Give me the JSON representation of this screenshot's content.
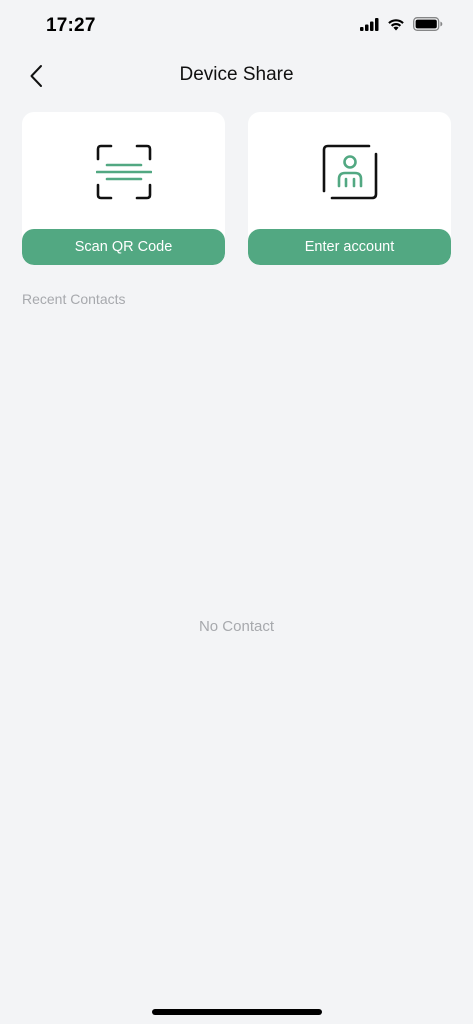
{
  "status_bar": {
    "time": "17:27"
  },
  "header": {
    "title": "Device Share"
  },
  "share_options": [
    {
      "label": "Scan QR Code",
      "icon": "scan-qr-icon"
    },
    {
      "label": "Enter account",
      "icon": "account-icon"
    }
  ],
  "recent_contacts": {
    "label": "Recent Contacts",
    "empty_text": "No Contact"
  },
  "colors": {
    "accent": "#52a882",
    "background": "#f3f4f6",
    "muted_text": "#a7a9ad"
  }
}
